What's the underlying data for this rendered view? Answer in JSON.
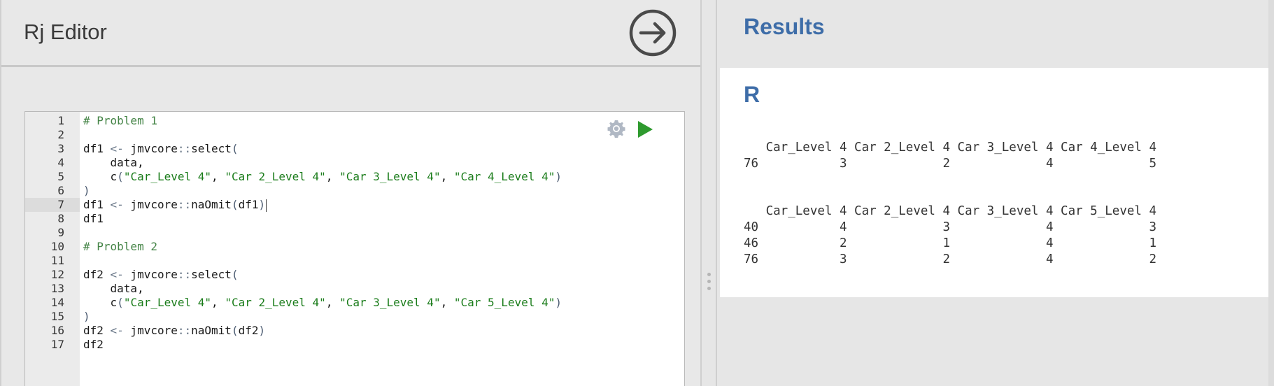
{
  "editor": {
    "title": "Rj Editor",
    "line_numbers": [
      "1",
      "2",
      "3",
      "4",
      "5",
      "6",
      "7",
      "8",
      "9",
      "10",
      "11",
      "12",
      "13",
      "14",
      "15",
      "16",
      "17"
    ],
    "code_lines": [
      "# Problem 1",
      "",
      "df1 <- jmvcore::select(",
      "    data,",
      "    c(\"Car_Level 4\", \"Car 2_Level 4\", \"Car 3_Level 4\", \"Car 4_Level 4\")",
      ")",
      "df1 <- jmvcore::naOmit(df1)",
      "df1",
      "",
      "# Problem 2",
      "",
      "df2 <- jmvcore::select(",
      "    data,",
      "    c(\"Car_Level 4\", \"Car 2_Level 4\", \"Car 3_Level 4\", \"Car 5_Level 4\")",
      ")",
      "df2 <- jmvcore::naOmit(df2)",
      "df2"
    ],
    "active_line": 7
  },
  "icons": {
    "run_circle": "arrow-right-circle-icon",
    "settings": "gear-icon",
    "run": "play-icon"
  },
  "results": {
    "title": "Results",
    "section_heading": "R",
    "output1": "   Car_Level 4 Car 2_Level 4 Car 3_Level 4 Car 4_Level 4\n76           3             2             4             5",
    "output2": "   Car_Level 4 Car 2_Level 4 Car 3_Level 4 Car 5_Level 4\n40           4             3             4             3\n46           2             1             4             1\n76           3             2             4             2"
  },
  "colors": {
    "accent": "#3e6da8",
    "run_green": "#2e9a2e",
    "gear_gray": "#b0b8c4"
  }
}
